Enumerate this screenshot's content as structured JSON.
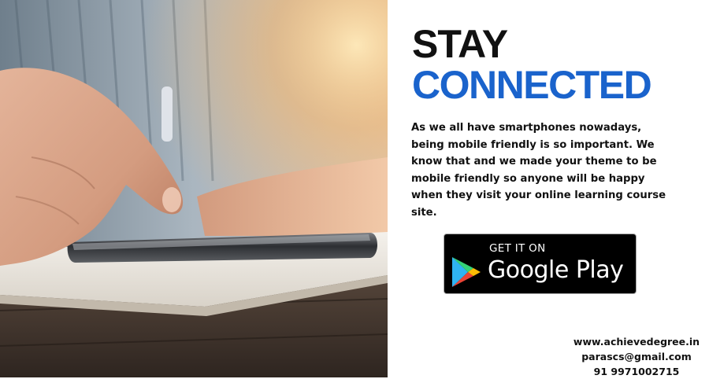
{
  "headline": {
    "line1": "STAY",
    "line2": "CONNECTED"
  },
  "description": "As we all have smartphones nowadays, being mobile friendly is so important. We know that and we made your theme to be mobile friendly so anyone will be happy when they visit your online learning course site.",
  "store_badge": {
    "small_text": "GET IT ON",
    "big_text": "Google Play"
  },
  "contact": {
    "website": "www.achievedegree.in",
    "email": "parascs@gmail.com",
    "phone": "91 9971002715"
  },
  "colors": {
    "headline_dark": "#111111",
    "headline_accent": "#1a63cc",
    "badge_background": "#000000"
  }
}
